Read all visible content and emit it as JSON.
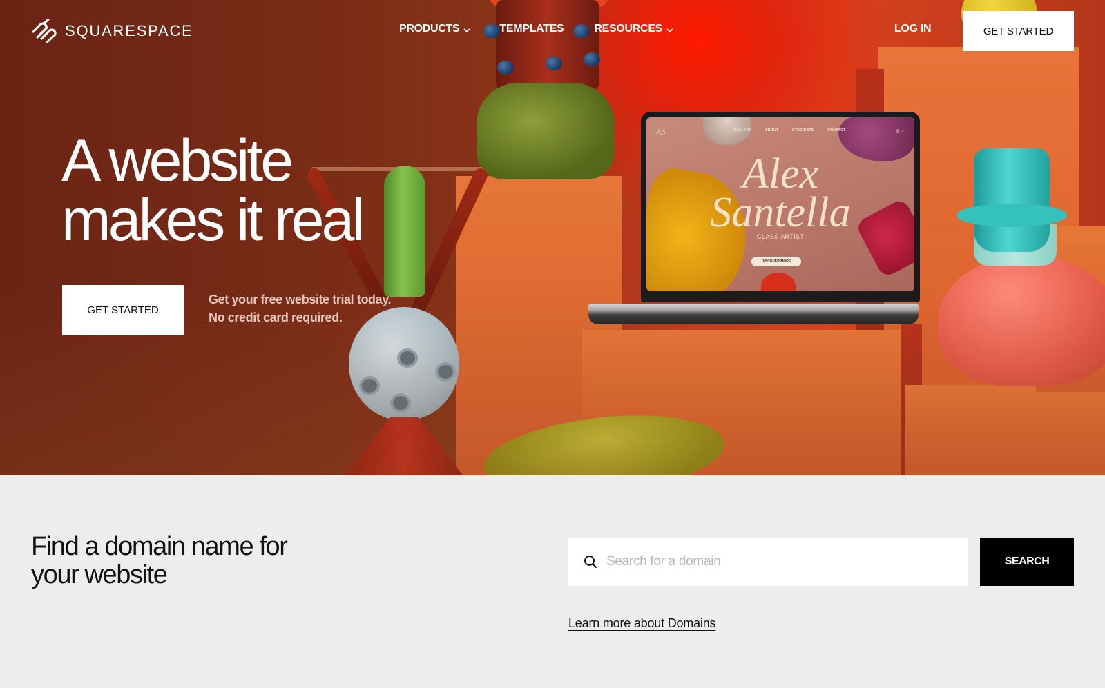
{
  "nav": {
    "brand": "SQUARESPACE",
    "links": [
      {
        "label": "PRODUCTS",
        "has_dropdown": true
      },
      {
        "label": "TEMPLATES",
        "has_dropdown": false
      },
      {
        "label": "RESOURCES",
        "has_dropdown": true
      }
    ],
    "login_label": "LOG IN",
    "cta_label": "GET STARTED"
  },
  "hero": {
    "headline_line1": "A website",
    "headline_line2": "makes it real",
    "cta_label": "GET STARTED",
    "note_line1": "Get your free website trial today.",
    "note_line2": "No credit card required.",
    "laptop_site": {
      "logo": "AS",
      "nav": [
        "GALLERY",
        "ABOUT",
        "STOCKISTS",
        "CONTACT"
      ],
      "title_line1": "Alex",
      "title_line2": "Santella",
      "subtitle": "GLASS ARTIST",
      "button": "DISCOVER MORE"
    }
  },
  "domain": {
    "title_line1": "Find a domain name for",
    "title_line2": "your website",
    "search_placeholder": "Search for a domain",
    "search_value": "",
    "search_button": "SEARCH",
    "learn_more": "Learn more about Domains"
  },
  "colors": {
    "hero_bg": "#7a2c17",
    "accent_red": "#e2451f",
    "section_bg": "#ededed",
    "button_dark": "#000000",
    "button_light": "#ffffff"
  }
}
